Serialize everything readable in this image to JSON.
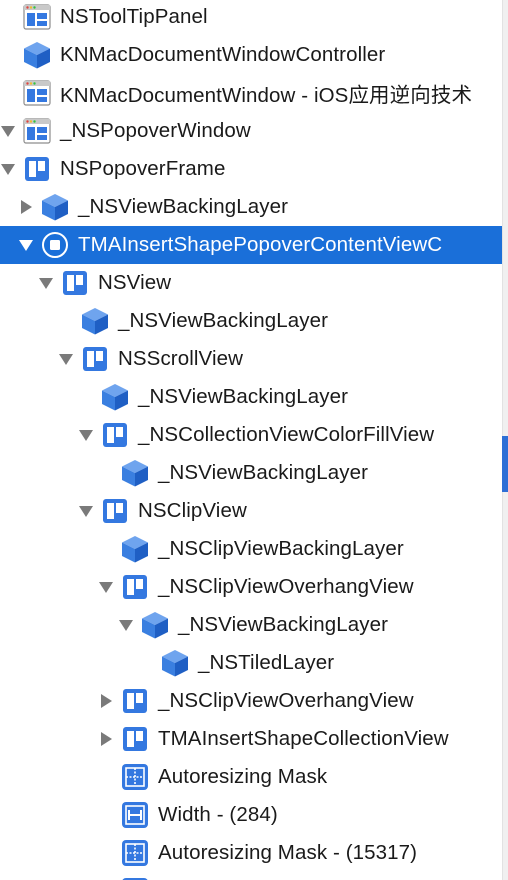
{
  "colors": {
    "accent": "#1a6fd9",
    "icon_blue": "#3478e0",
    "disclosure_gray": "#7a7a7a"
  },
  "tree": {
    "rows": [
      {
        "label": "NSToolTipPanel",
        "level": 0,
        "disclosure": "none",
        "icon": "window-icon"
      },
      {
        "label": "KNMacDocumentWindowController",
        "level": 0,
        "disclosure": "none",
        "icon": "cube-icon"
      },
      {
        "label": "KNMacDocumentWindow - iOS应用逆向技术",
        "level": 0,
        "disclosure": "none",
        "icon": "window-icon"
      },
      {
        "label": "_NSPopoverWindow",
        "level": 0,
        "disclosure": "expanded",
        "icon": "window-icon"
      },
      {
        "label": "NSPopoverFrame",
        "level": 1,
        "disclosure": "expanded",
        "icon": "view-icon"
      },
      {
        "label": "_NSViewBackingLayer",
        "level": 2,
        "disclosure": "collapsed",
        "icon": "cube-icon"
      },
      {
        "label": "TMAInsertShapePopoverContentViewC",
        "level": 2,
        "disclosure": "expanded",
        "icon": "view-controller-icon",
        "selected": true
      },
      {
        "label": "NSView",
        "level": 3,
        "disclosure": "expanded",
        "icon": "view-icon"
      },
      {
        "label": "_NSViewBackingLayer",
        "level": 4,
        "disclosure": "none",
        "icon": "cube-icon"
      },
      {
        "label": "NSScrollView",
        "level": 4,
        "disclosure": "expanded",
        "icon": "view-icon"
      },
      {
        "label": "_NSViewBackingLayer",
        "level": 5,
        "disclosure": "none",
        "icon": "cube-icon"
      },
      {
        "label": "_NSCollectionViewColorFillView",
        "level": 5,
        "disclosure": "expanded",
        "icon": "view-icon"
      },
      {
        "label": "_NSViewBackingLayer",
        "level": 6,
        "disclosure": "none",
        "icon": "cube-icon"
      },
      {
        "label": "NSClipView",
        "level": 5,
        "disclosure": "expanded",
        "icon": "view-icon"
      },
      {
        "label": "_NSClipViewBackingLayer",
        "level": 6,
        "disclosure": "none",
        "icon": "cube-icon"
      },
      {
        "label": "_NSClipViewOverhangView",
        "level": 6,
        "disclosure": "expanded",
        "icon": "view-icon"
      },
      {
        "label": "_NSViewBackingLayer",
        "level": 7,
        "disclosure": "expanded",
        "icon": "cube-icon"
      },
      {
        "label": "_NSTiledLayer",
        "level": 8,
        "disclosure": "none",
        "icon": "cube-icon"
      },
      {
        "label": "_NSClipViewOverhangView",
        "level": 6,
        "disclosure": "collapsed",
        "icon": "view-icon"
      },
      {
        "label": "TMAInsertShapeCollectionView",
        "level": 6,
        "disclosure": "collapsed",
        "icon": "view-icon"
      },
      {
        "label": "Autoresizing Mask",
        "level": 6,
        "disclosure": "none",
        "icon": "autoresizing-constraint-icon"
      },
      {
        "label": "Width - (284)",
        "level": 6,
        "disclosure": "none",
        "icon": "width-constraint-icon"
      },
      {
        "label": "Autoresizing Mask - (15317)",
        "level": 6,
        "disclosure": "none",
        "icon": "autoresizing-constraint-icon"
      },
      {
        "label": "",
        "level": 6,
        "disclosure": "none",
        "icon": "autoresizing-constraint-icon"
      }
    ]
  }
}
